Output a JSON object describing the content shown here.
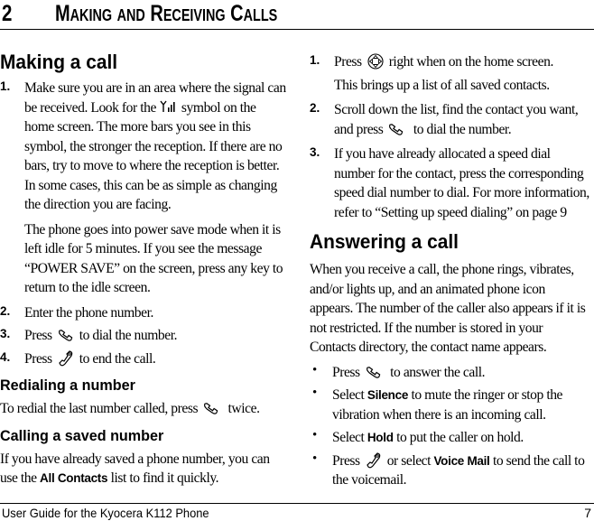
{
  "header": {
    "chapter_number": "2",
    "chapter_title": "Making and Receiving Calls"
  },
  "icons": {
    "signal": "signal-strength-icon",
    "send": "send-key-icon",
    "end": "end-key-icon",
    "nav": "navigation-key-icon"
  },
  "making_call": {
    "heading": "Making a call",
    "steps": [
      {
        "label": "1.",
        "text_before": "Make sure you are in an area where the signal can be received. Look for the",
        "text_after": "symbol on the home screen. The more bars you see in this symbol, the stronger the reception. If there are no bars, try to move to where the reception is better. In some cases, this can be as simple as changing the direction you are facing.",
        "note": "The phone goes into power save mode when it is left idle for 5 minutes. If you see the message “POWER SAVE” on the screen, press any key to return to the idle screen."
      },
      {
        "label": "2.",
        "text": "Enter the phone number."
      },
      {
        "label": "3.",
        "text_before": "Press",
        "text_after": "to dial the number."
      },
      {
        "label": "4.",
        "text_before": "Press",
        "text_after": "to end the call."
      }
    ]
  },
  "redialing": {
    "heading": "Redialing a number",
    "text_before": "To redial the last number called, press",
    "text_after": "twice."
  },
  "saved_number": {
    "heading": "Calling a saved number",
    "text_before": "If you have already saved a phone number, you can use the",
    "keyword": "All Contacts",
    "text_after": "list to find it quickly.",
    "steps": [
      {
        "label": "1.",
        "text_before": "Press",
        "text_after": "right when on the home screen.",
        "note": "This brings up a list of all saved contacts."
      },
      {
        "label": "2.",
        "text_before": "Scroll down the list, find the contact you want, and press",
        "text_after": "to dial the number."
      },
      {
        "label": "3.",
        "text": "If you have already allocated a speed dial number for the contact, press the corresponding speed dial number to dial. For more information, refer to “Setting up speed dialing” on page 9"
      }
    ]
  },
  "answering": {
    "heading": "Answering a call",
    "intro": "When you receive a call, the phone rings, vibrates, and/or lights up, and an animated phone icon appears. The number of the caller also appears if it is not restricted. If the number is stored in your Contacts directory, the contact name appears.",
    "bullets": [
      {
        "text_before": "Press",
        "text_after": "to answer the call."
      },
      {
        "text_before": "Select",
        "keyword": "Silence",
        "text_after": "to mute the ringer or stop the vibration when there is an incoming call."
      },
      {
        "text_before": "Select",
        "keyword": "Hold",
        "text_after": "to put the caller on hold."
      },
      {
        "text_before": "Press",
        "text_mid": "or select",
        "keyword": "Voice Mail",
        "text_after": "to send the call to the voicemail."
      }
    ],
    "bullet_char": "•"
  },
  "footer": {
    "title": "User Guide for the Kyocera K112 Phone",
    "page_number": "7"
  }
}
